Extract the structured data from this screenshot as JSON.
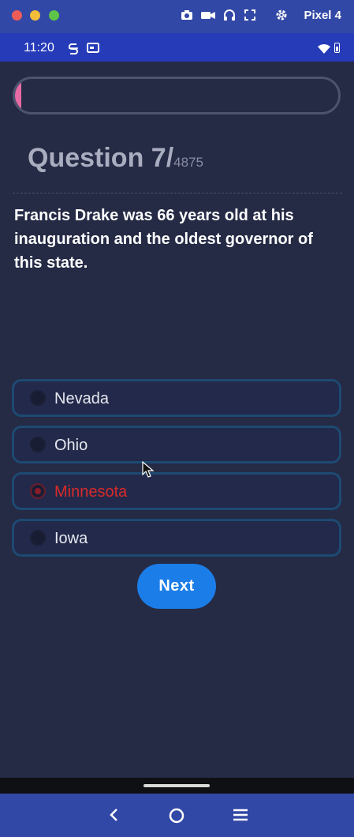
{
  "emulator": {
    "device_name": "Pixel 4",
    "icons": [
      "camera-icon",
      "video-icon",
      "headphones-icon",
      "fullscreen-icon",
      "gear-icon"
    ]
  },
  "status_bar": {
    "time": "11:20",
    "icons": [
      "s-icon",
      "card-icon",
      "wifi-icon",
      "battery-icon"
    ]
  },
  "quiz": {
    "progress_fraction": 0.02,
    "question_label": "Question 7/",
    "question_total": "4875",
    "question_text": "Francis Drake was 66 years old at his inauguration and the oldest governor of this state.",
    "options": [
      {
        "label": "Nevada",
        "selected": false
      },
      {
        "label": "Ohio",
        "selected": false
      },
      {
        "label": "Minnesota",
        "selected": true
      },
      {
        "label": "Iowa",
        "selected": false
      }
    ],
    "next_label": "Next"
  },
  "nav": {
    "buttons": [
      "back-icon",
      "home-icon",
      "menu-icon"
    ]
  },
  "colors": {
    "background": "#252a45",
    "accent": "#1b7ee8",
    "progress": "#e66ba5",
    "selected_wrong": "#d82a2a"
  }
}
